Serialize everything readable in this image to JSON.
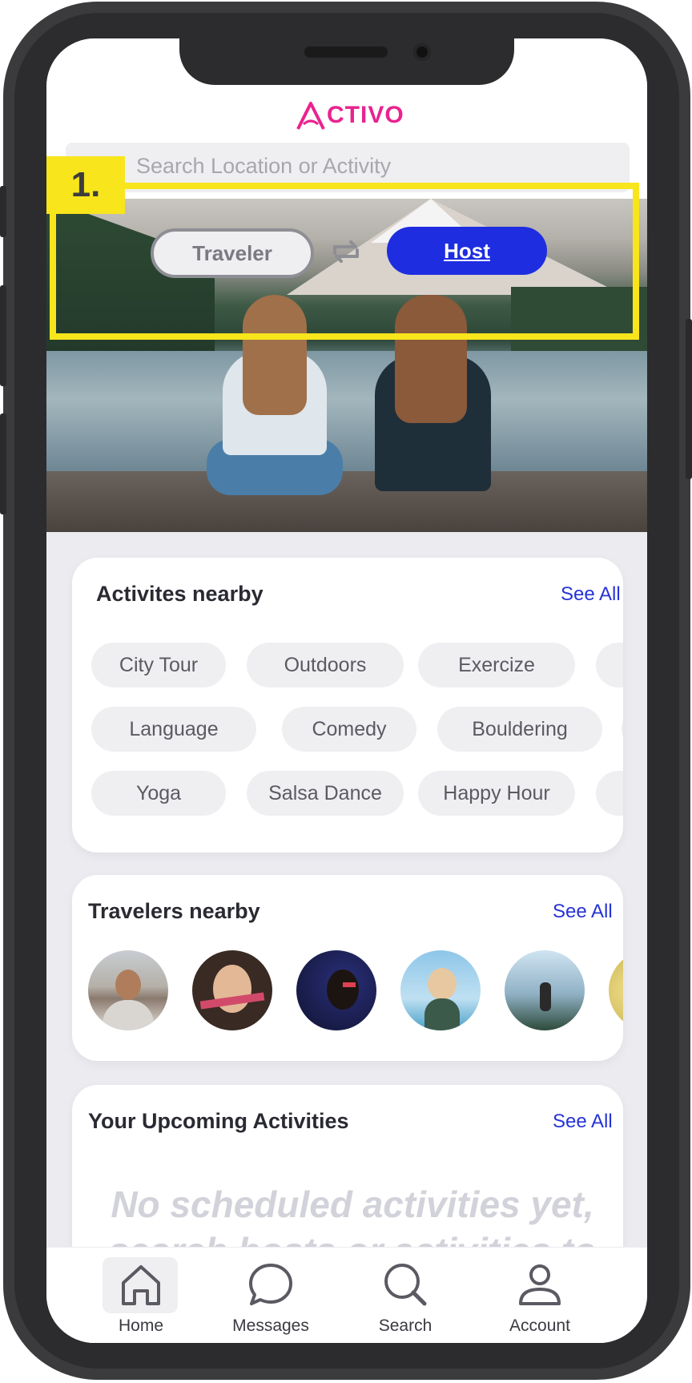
{
  "app": {
    "name": "ACTIVO"
  },
  "search": {
    "placeholder": "Search Location or Activity"
  },
  "annotation": {
    "label": "1."
  },
  "mode_toggle": {
    "traveler_label": "Traveler",
    "host_label": "Host",
    "active": "Host"
  },
  "activities_card": {
    "title": "Activites nearby",
    "see_all": "See All",
    "rows": [
      [
        "City Tour",
        "Outdoors",
        "Exercize"
      ],
      [
        "Language",
        "Comedy",
        "Bouldering"
      ],
      [
        "Yoga",
        "Salsa Dance",
        "Happy Hour"
      ]
    ]
  },
  "travelers_card": {
    "title": "Travelers nearby",
    "see_all": "See All"
  },
  "upcoming_card": {
    "title": "Your Upcoming Activities",
    "see_all": "See All",
    "empty_text": "No scheduled activities yet, search hosts or activities to"
  },
  "nav": {
    "home": "Home",
    "messages": "Messages",
    "search": "Search",
    "account": "Account",
    "active": "Home"
  },
  "colors": {
    "brand": "#e9238f",
    "accent": "#1e2de0",
    "annotation": "#f8e51c"
  }
}
